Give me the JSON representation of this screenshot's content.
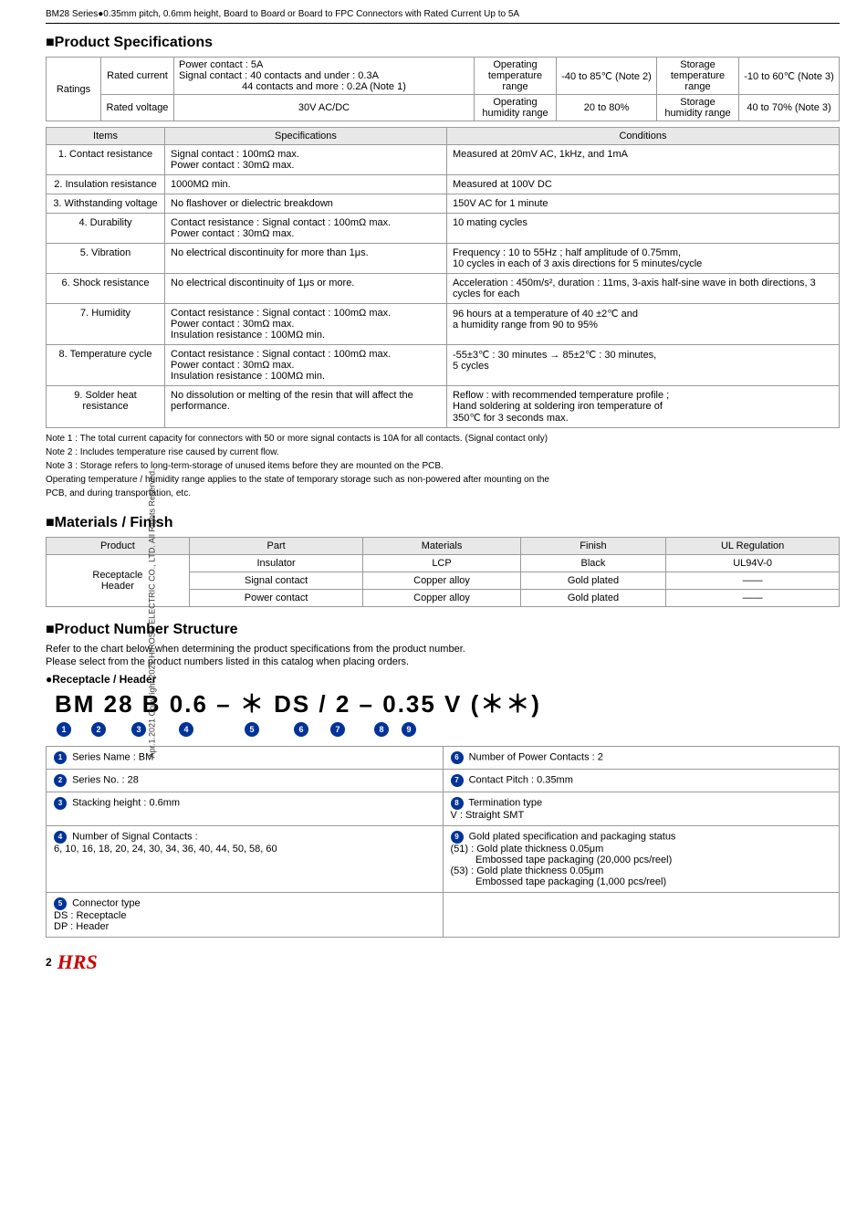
{
  "header": {
    "title": "BM28 Series●0.35mm pitch, 0.6mm height, Board to Board or Board to FPC Connectors with Rated Current Up to 5A"
  },
  "vertical_side_text": "Apr.1.2021 Copyright 2021 HIROSE ELECTRIC CO., LTD. All Rights Reserved.",
  "product_specs": {
    "title": "■Product Specifications",
    "ratings": {
      "label": "Ratings",
      "row1_left_label": "Rated current",
      "row1_left_val1": "Power contact : 5A",
      "row1_left_val2": "Signal contact : 40 contacts and under : 0.3A",
      "row1_left_val3": "44 contacts and more  : 0.2A (Note 1)",
      "row1_mid_label": "Operating temperature range",
      "row1_mid_val": "-40 to 85℃ (Note 2)",
      "row1_right_label": "Storage temperature range",
      "row1_right_val": "-10 to 60℃ (Note 3)",
      "row2_left_label": "Rated voltage",
      "row2_left_val": "30V AC/DC",
      "row2_mid_label": "Operating humidity range",
      "row2_mid_val": "20 to 80%",
      "row2_right_label": "Storage humidity range",
      "row2_right_val": "40 to 70% (Note 3)"
    },
    "table_headers": [
      "Items",
      "Specifications",
      "Conditions"
    ],
    "rows": [
      {
        "item": "1. Contact resistance",
        "spec": "Signal contact : 100mΩ max.\nPower contact : 30mΩ max.",
        "cond": "Measured at 20mV AC, 1kHz, and 1mA"
      },
      {
        "item": "2. Insulation resistance",
        "spec": "1000MΩ min.",
        "cond": "Measured at 100V DC"
      },
      {
        "item": "3. Withstanding voltage",
        "spec": "No flashover or dielectric breakdown",
        "cond": "150V AC for 1 minute"
      },
      {
        "item": "4. Durability",
        "spec": "Contact resistance : Signal contact : 100mΩ max.\nPower contact : 30mΩ max.",
        "cond": "10 mating cycles"
      },
      {
        "item": "5. Vibration",
        "spec": "No electrical discontinuity for more than 1μs.",
        "cond": "Frequency : 10 to 55Hz ; half amplitude of 0.75mm,\n10 cycles in each of 3 axis directions for 5 minutes/cycle"
      },
      {
        "item": "6. Shock resistance",
        "spec": "No electrical discontinuity of 1μs or more.",
        "cond": "Acceleration : 450m/s², duration : 11ms, 3-axis half-sine wave in both directions, 3 cycles for each"
      },
      {
        "item": "7. Humidity",
        "spec": "Contact resistance : Signal contact : 100mΩ max.\nPower contact : 30mΩ max.\nInsulation resistance : 100MΩ min.",
        "cond": "96 hours at a temperature of 40 ±2℃ and\na humidity range from 90 to 95%"
      },
      {
        "item": "8. Temperature cycle",
        "spec": "Contact resistance : Signal contact : 100mΩ max.\nPower contact : 30mΩ max.\nInsulation resistance : 100MΩ min.",
        "cond": "-55±3℃ : 30 minutes → 85±2℃ : 30 minutes,\n5 cycles"
      },
      {
        "item": "9. Solder heat resistance",
        "spec": "No dissolution or melting of the resin that will affect the performance.",
        "cond": "Reflow : with recommended temperature profile ;\nHand soldering at soldering iron temperature of\n350℃ for 3 seconds max."
      }
    ],
    "notes": [
      "Note 1 : The total current capacity for connectors with 50 or more signal contacts is 10A for all contacts. (Signal contact only)",
      "Note 2 : Includes temperature rise caused by current flow.",
      "Note 3 : Storage refers to long-term-storage of unused items before they are mounted on the PCB.",
      "         Operating temperature / humidity range applies to the state of temporary storage such as non-powered after mounting on the",
      "         PCB, and during transportation, etc."
    ]
  },
  "materials_finish": {
    "title": "■Materials / Finish",
    "headers": [
      "Product",
      "Part",
      "Materials",
      "Finish",
      "UL Regulation"
    ],
    "product": "Receptacle\nHeader",
    "rows": [
      {
        "part": "Insulator",
        "materials": "LCP",
        "finish": "Black",
        "ul": "UL94V-0"
      },
      {
        "part": "Signal contact",
        "materials": "Copper alloy",
        "finish": "Gold plated",
        "ul": "——"
      },
      {
        "part": "Power contact",
        "materials": "Copper alloy",
        "finish": "Gold plated",
        "ul": "——"
      }
    ]
  },
  "product_number": {
    "title": "■Product Number Structure",
    "desc1": "Refer to the chart below when determining the product specifications from the product number.",
    "desc2": "Please select from the product numbers listed in this catalog when placing orders.",
    "sub_title": "●Receptacle / Header",
    "pn_display": "BM 28 B 0.6 – ＊ DS / 2 – 0.35 V (＊＊)",
    "legend": [
      {
        "num": "❶",
        "label": "❶ Series Name : BM"
      },
      {
        "num": "❻",
        "label": "❻ Number of Power Contacts : 2"
      },
      {
        "num": "❷",
        "label": "❷ Series No. : 28"
      },
      {
        "num": "❼",
        "label": "❼ Contact Pitch : 0.35mm"
      },
      {
        "num": "❸",
        "label": "❸ Stacking height : 0.6mm"
      },
      {
        "num": "❽",
        "label": "❽ Termination type\n   V : Straight SMT"
      },
      {
        "num": "❹",
        "label": "❹ Number of Signal Contacts :\n   6, 10, 16, 18, 20, 24, 30, 34, 36, 40, 44, 50, 58, 60"
      },
      {
        "num": "❾",
        "label": "❾ Gold plated specification and packaging status\n   (51) : Gold plate thickness 0.05μm\n          Embossed tape packaging (20,000 pcs/reel)\n   (53) : Gold plate thickness 0.05μm\n          Embossed tape packaging (1,000 pcs/reel)"
      },
      {
        "num": "❺",
        "label": "❺ Connector type\n   DS : Receptacle\n   DP : Header"
      },
      {
        "num": "",
        "label": ""
      }
    ]
  },
  "page_num": "2"
}
